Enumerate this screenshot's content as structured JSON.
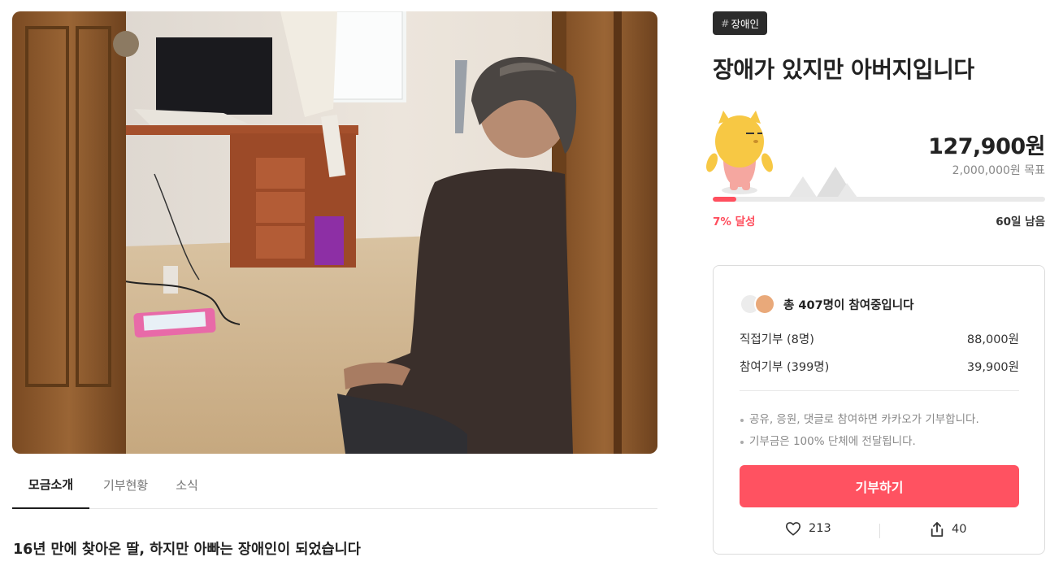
{
  "hashtag": {
    "symbol": "#",
    "label": "장애인"
  },
  "title": "장애가 있지만 아버지입니다",
  "funding": {
    "raised": "127,900원",
    "goal": "2,000,000원 목표",
    "percent_label": "7% 달성",
    "progress": 0.07,
    "days_left": "60일 남음"
  },
  "participation": {
    "summary": "총 407명이 참여중입니다",
    "direct_label": "직접기부 (8명)",
    "direct_amount": "88,000원",
    "engaged_label": "참여기부 (399명)",
    "engaged_amount": "39,900원"
  },
  "notes": [
    "공유, 응원, 댓글로 참여하면 카카오가 기부합니다.",
    "기부금은 100% 단체에 전달됩니다."
  ],
  "donate_button": "기부하기",
  "likes": "213",
  "shares": "40",
  "tabs": [
    "모금소개",
    "기부현황",
    "소식"
  ],
  "story_heading": "16년 만에 찾아온 딸, 하지만 아빠는 장애인이 되었습니다",
  "colors": {
    "accent": "#ff5261",
    "dark": "#222222",
    "muted": "#888888"
  },
  "icons": {
    "like": "heart-icon",
    "share": "share-icon"
  }
}
